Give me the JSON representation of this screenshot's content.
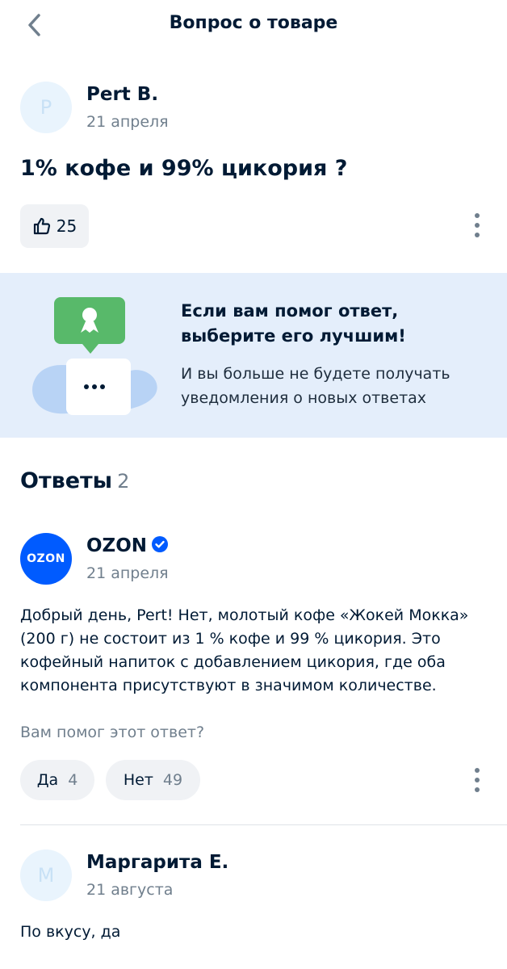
{
  "header": {
    "title": "Вопрос о товаре",
    "back_icon": "chevron-left-icon"
  },
  "question": {
    "author": {
      "initial": "P",
      "name": "Pert B.",
      "date": "21 апреля"
    },
    "text": "1% кофе и 99% цикория ?",
    "likes": "25"
  },
  "banner": {
    "title": "Если вам помог ответ, выберите его лучшим!",
    "subtitle": "И вы больше не будете получать уведомления о новых ответах"
  },
  "answers": {
    "title": "Ответы",
    "count": "2",
    "items": [
      {
        "author": {
          "logo_text": "OZON",
          "name": "OZON",
          "date": "21 апреля",
          "verified": true
        },
        "text": "Добрый день, Pert! Нет, молотый кофе «Жокей Мокка» (200 г) не состоит из 1 % кофе и 99 % цикория. Это кофейный напиток с добавлением цикория, где оба компонента присутствуют в значимом количестве.",
        "helpful_question": "Вам помог этот ответ?",
        "yes_label": "Да",
        "yes_count": "4",
        "no_label": "Нет",
        "no_count": "49"
      },
      {
        "author": {
          "initial": "М",
          "name": "Маргарита Е.",
          "date": "21 августа"
        },
        "text": "По вкусу, да"
      }
    ]
  },
  "colors": {
    "accent": "#005bff",
    "banner_bg": "#e4eefb",
    "green": "#58b96a",
    "text": "#001a34",
    "muted": "#707f8d"
  }
}
